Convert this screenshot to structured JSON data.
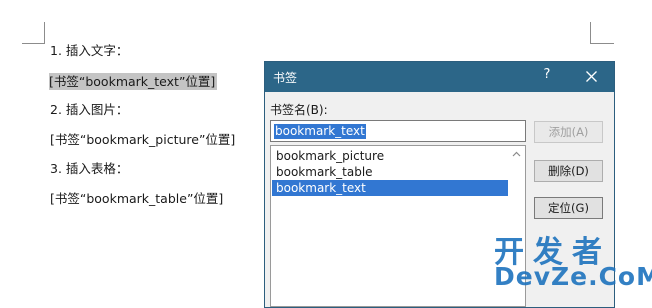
{
  "document": {
    "lines": [
      "1. 插入文字：",
      "[书签“bookmark_text”位置]",
      "2. 插入图片：",
      "[书签“bookmark_picture”位置]",
      "3. 插入表格：",
      "[书签“bookmark_table”位置]"
    ]
  },
  "dialog": {
    "title": "书签",
    "help": "?",
    "name_label": "书签名(B):",
    "name_value": "bookmark_text",
    "list": [
      "bookmark_picture",
      "bookmark_table",
      "bookmark_text"
    ],
    "selected_index": 2,
    "buttons": {
      "add": "添加(A)",
      "delete": "删除(D)",
      "goto": "定位(G)"
    },
    "colors": {
      "titlebar": "#2c6688",
      "selection": "#3277d2"
    }
  },
  "watermark": {
    "top": "开发者",
    "bottom": "DevZe.CoM"
  }
}
